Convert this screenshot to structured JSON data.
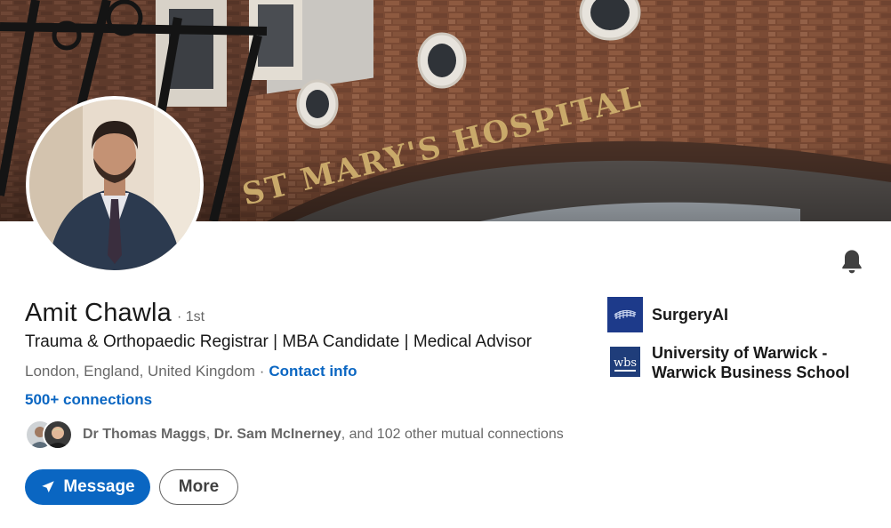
{
  "cover": {
    "sign_text": "ST MARY'S HOSPITAL"
  },
  "profile": {
    "name": "Amit Chawla",
    "degree": "· 1st",
    "headline": "Trauma & Orthopaedic Registrar | MBA Candidate | Medical Advisor",
    "location": "London, England, United Kingdom ·",
    "contact_label": "Contact info",
    "connections_label": "500+ connections"
  },
  "mutual": {
    "name1": "Dr Thomas Maggs",
    "sep": ",",
    "name2": "Dr. Sam McInerney",
    "rest": ", and 102 other mutual connections"
  },
  "actions": {
    "message_label": "Message",
    "more_label": "More"
  },
  "orgs": [
    {
      "name": "SurgeryAI",
      "logo_color": "#1d3a8a"
    },
    {
      "name": "University of Warwick - Warwick Business School",
      "logo_text": "wbs",
      "logo_color": "#1f3d7a"
    }
  ],
  "colors": {
    "accent": "#0a66c2",
    "brick": "#8a5a3e"
  }
}
